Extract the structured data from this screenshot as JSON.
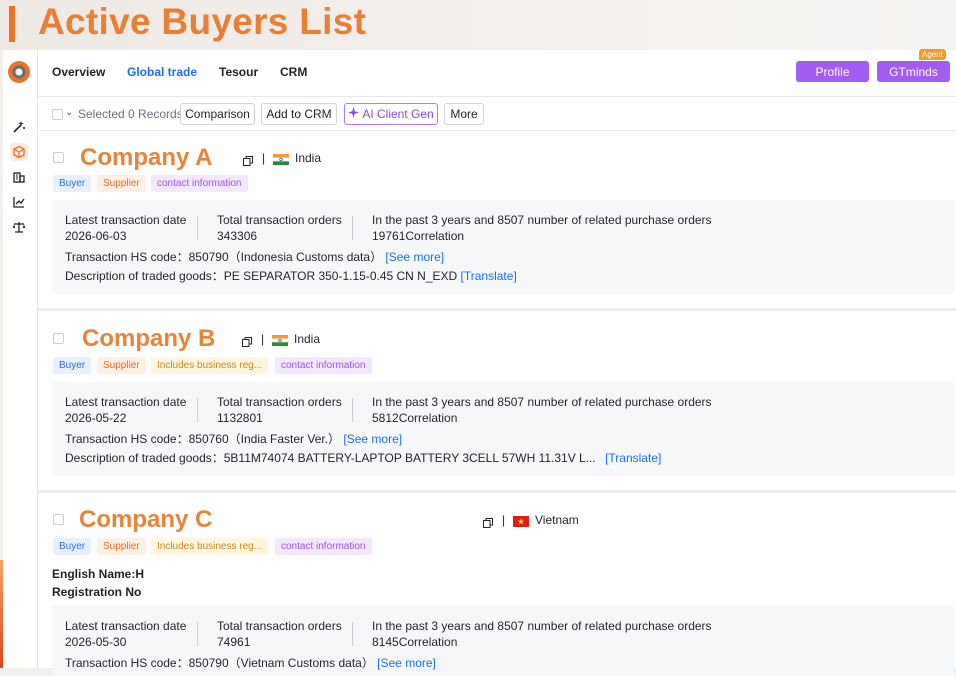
{
  "banner": {
    "title": "Active Buyers List"
  },
  "nav": {
    "tabs": [
      {
        "label": "Overview"
      },
      {
        "label": "Global trade"
      },
      {
        "label": "Tesour"
      },
      {
        "label": "CRM"
      }
    ],
    "profile_label": "Profile",
    "gtminds_label": "GTminds",
    "agent_badge": "Agent"
  },
  "toolbar": {
    "selected": "Selected 0 Records",
    "comparison": "Comparison",
    "add_crm": "Add to CRM",
    "ai_client": "AI Client Gen",
    "more": "More"
  },
  "companies": [
    {
      "name": "Company A",
      "country": "India",
      "tags": [
        "Buyer",
        "Supplier",
        "contact information"
      ],
      "latest_label": "Latest transaction date",
      "latest_value": "2026-06-03",
      "orders_label": "Total transaction orders",
      "orders_value": "343306",
      "related_label": "In the past 3 years and 8507 number of related purchase orders",
      "related_value": "19761Correlation",
      "hs_text": "Transaction HS code：850790（Indonesia Customs data）",
      "see_more": "[See more]",
      "desc_text": "Description of traded goods：PE SEPARATOR 350-1.15-0.45 CN N_EXD",
      "translate": "[Translate]"
    },
    {
      "name": "Company B",
      "country": "India",
      "tags": [
        "Buyer",
        "Supplier",
        "Includes business reg...",
        "contact information"
      ],
      "latest_label": "Latest transaction date",
      "latest_value": "2026-05-22",
      "orders_label": "Total transaction orders",
      "orders_value": "1132801",
      "related_label": "In the past 3 years and 8507 number of related purchase orders",
      "related_value": "5812Correlation",
      "hs_text": "Transaction HS code：850760（India Faster Ver.）",
      "see_more": "[See more]",
      "desc_text": "Description of traded goods：5B11M74074 BATTERY-LAPTOP BATTERY 3CELL 57WH 11.31V L...",
      "translate": "[Translate]"
    },
    {
      "name": "Company C",
      "country": "Vietnam",
      "tags": [
        "Buyer",
        "Supplier",
        "Includes business reg...",
        "contact information"
      ],
      "english_name_label": "English Name:H",
      "registration_label": "Registration No",
      "latest_label": "Latest transaction date",
      "latest_value": "2026-05-30",
      "orders_label": "Total transaction orders",
      "orders_value": "74961",
      "related_label": "In the past 3 years and 8507 number of related purchase orders",
      "related_value": "8145Correlation",
      "hs_text": "Transaction HS code：850790（Vietnam Customs data）",
      "see_more": "[See more]"
    }
  ],
  "colors": {
    "accent_orange": "#e8843a",
    "link_blue": "#1d6fe8",
    "purple_button": "#a55cf2"
  }
}
